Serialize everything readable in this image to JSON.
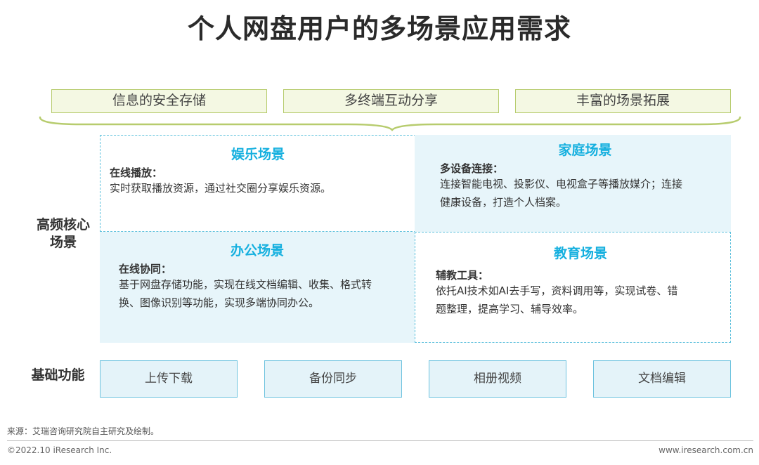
{
  "title": "个人网盘用户的多场景应用需求",
  "top_features": [
    "信息的安全存储",
    "多终端互动分享",
    "丰富的场景拓展"
  ],
  "side_labels": {
    "core_line1": "高频核心",
    "core_line2": "场景",
    "basic": "基础功能"
  },
  "scenarios": {
    "entertainment": {
      "title": "娱乐场景",
      "sub": "在线播放：",
      "desc": [
        "实时获取播放资源，通过社交圈分享娱乐资源。"
      ]
    },
    "home": {
      "title": "家庭场景",
      "sub": "多设备连接：",
      "desc": [
        "连接智能电视、投影仪、电视盒子等播放媒介；连接",
        "健康设备，打造个人档案。"
      ]
    },
    "office": {
      "title": "办公场景",
      "sub": "在线协同：",
      "desc": [
        "基于网盘存储功能，实现在线文档编辑、收集、格式转",
        "换、图像识别等功能，实现多端协同办公。"
      ]
    },
    "education": {
      "title": "教育场景",
      "sub": "辅教工具：",
      "desc": [
        "依托AI技术如AI去手写，资料调用等，实现试卷、错",
        "题整理，提高学习、辅导效率。"
      ]
    }
  },
  "basic_functions": [
    "上传下载",
    "备份同步",
    "相册视频",
    "文档编辑"
  ],
  "footer": {
    "source": "来源：艾瑞咨询研究院自主研究及绘制。",
    "copyright": "©2022.10 iResearch Inc.",
    "website": "www.iresearch.com.cn"
  },
  "colors": {
    "accent_blue": "#16b0df",
    "feature_green": "#b7cc6e",
    "quad_fill": "#e7f5fa"
  }
}
